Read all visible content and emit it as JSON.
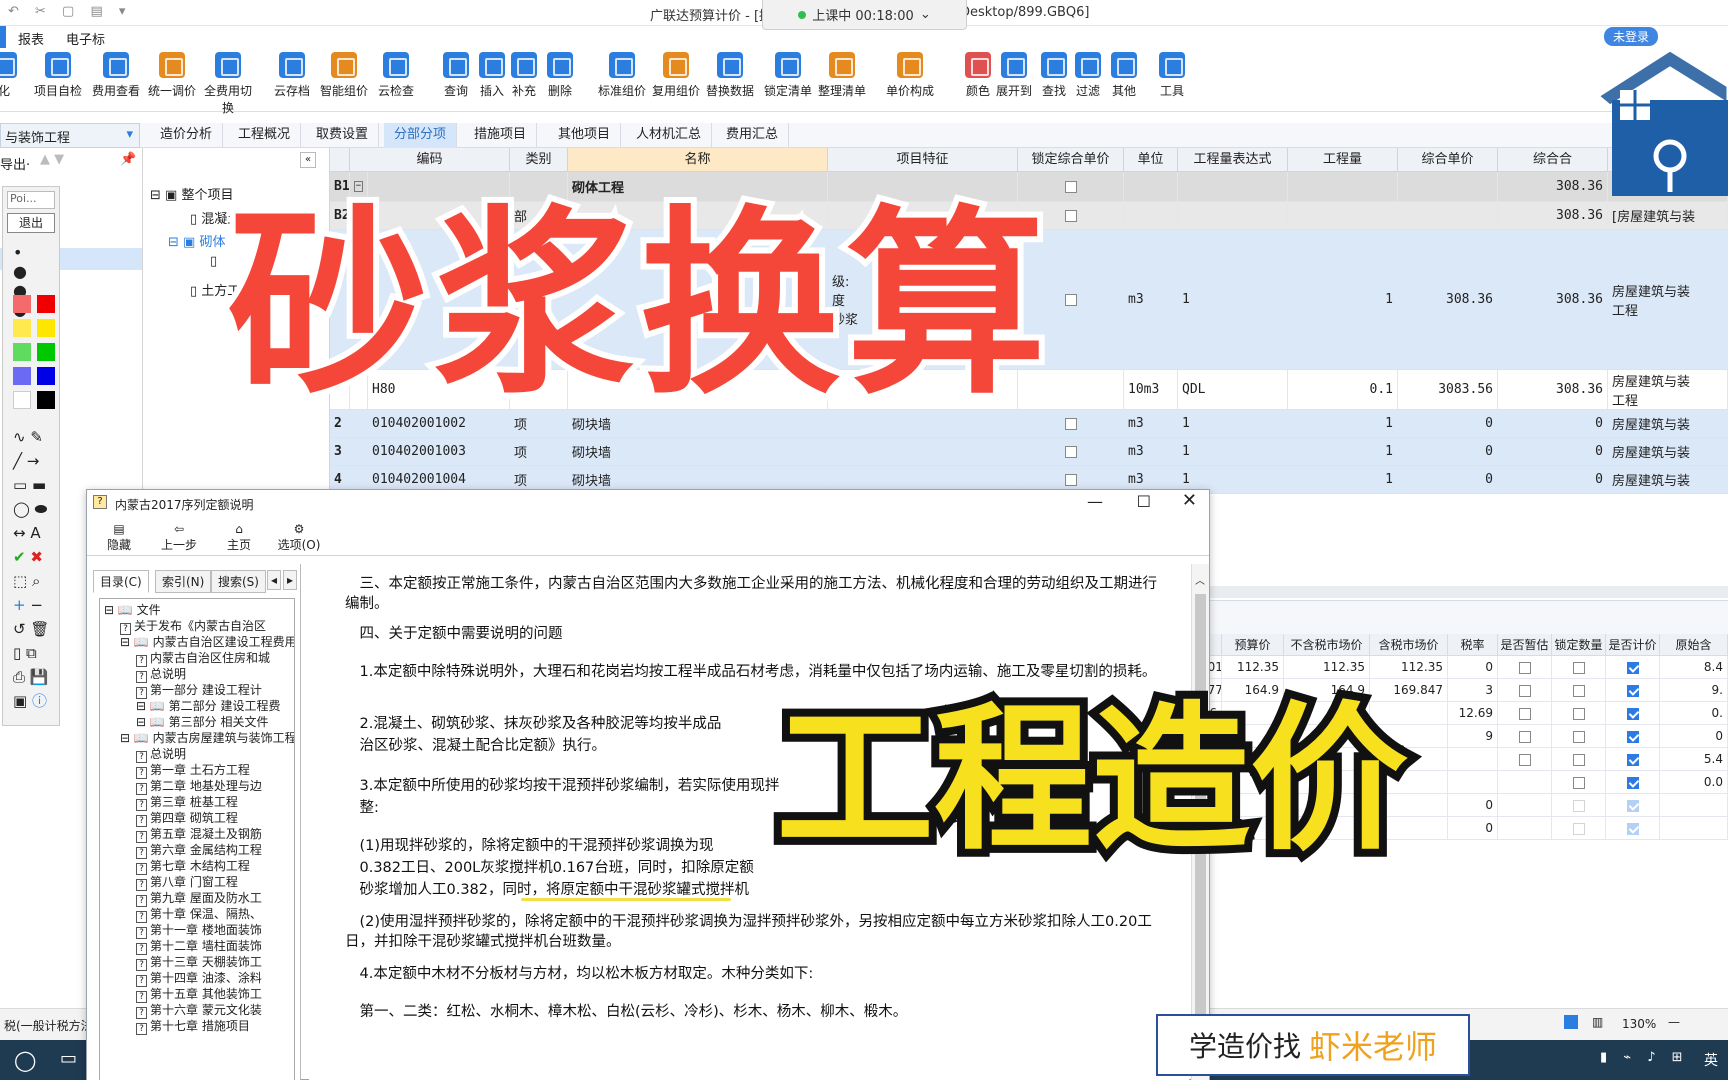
{
  "window": {
    "title": "广联达预算计价 - [招",
    "title_tail": "Desktop/899.GBQ6]",
    "timer": "上课中 00:18:00",
    "login": "未登录"
  },
  "menu": [
    "报表",
    "电子标"
  ],
  "ribbon": [
    {
      "label": "化",
      "color": "#2b7de0"
    },
    {
      "label": "项目自检",
      "color": "#2b7de0"
    },
    {
      "label": "费用查看",
      "color": "#2b7de0"
    },
    {
      "label": "统一调价",
      "color": "#e58a1f"
    },
    {
      "label": "全费用切换",
      "color": "#2b7de0"
    },
    {
      "label": "云存档",
      "color": "#2b7de0"
    },
    {
      "label": "智能组价",
      "color": "#e58a1f"
    },
    {
      "label": "云检查",
      "color": "#2b7de0"
    },
    {
      "label": "查询",
      "color": "#2b7de0"
    },
    {
      "label": "插入",
      "color": "#2b7de0"
    },
    {
      "label": "补充",
      "color": "#2b7de0"
    },
    {
      "label": "删除",
      "color": "#2b7de0"
    },
    {
      "label": "标准组价",
      "color": "#2b7de0"
    },
    {
      "label": "复用组价",
      "color": "#e58a1f"
    },
    {
      "label": "替换数据",
      "color": "#2b7de0"
    },
    {
      "label": "锁定清单",
      "color": "#2b7de0"
    },
    {
      "label": "整理清单",
      "color": "#e58a1f"
    },
    {
      "label": "单价构成",
      "color": "#e58a1f"
    },
    {
      "label": "颜色",
      "color": "#e05050"
    },
    {
      "label": "展开到",
      "color": "#2b7de0"
    },
    {
      "label": "查找",
      "color": "#2b7de0"
    },
    {
      "label": "过滤",
      "color": "#2b7de0"
    },
    {
      "label": "其他",
      "color": "#2b7de0"
    },
    {
      "label": "工具",
      "color": "#2b7de0"
    }
  ],
  "project_selector": "与装饰工程",
  "tabs": [
    "造价分析",
    "工程概况",
    "取费设置",
    "分部分项",
    "措施项目",
    "其他项目",
    "人材机汇总",
    "费用汇总"
  ],
  "left_tools": {
    "export": "导出·",
    "poi": "Poi...",
    "exit": "退出"
  },
  "tree": [
    "整个项目",
    "混凝土工程",
    "砌体",
    "土方工"
  ],
  "grid": {
    "headers": [
      "编码",
      "类别",
      "名称",
      "项目特征",
      "锁定综合单价",
      "单位",
      "工程量表达式",
      "工程量",
      "综合单价",
      "综合合"
    ],
    "rows": [
      {
        "no": "B1",
        "code": "",
        "type": "",
        "name": "砌体工程",
        "feature": "",
        "unit": "",
        "expr": "",
        "qty": "",
        "price": "",
        "total": "308.36",
        "major": "[房屋建筑与"
      },
      {
        "no": "B2",
        "code": "",
        "type": "部",
        "name": "",
        "feature": "",
        "unit": "",
        "expr": "",
        "qty": "",
        "price": "",
        "total": "308.36",
        "major": "[房屋建筑与装"
      },
      {
        "no": "",
        "code": "",
        "type": "",
        "name": "",
        "feature": "级:\n度\n砂浆",
        "unit": "m3",
        "expr": "1",
        "qty": "1",
        "price": "308.36",
        "total": "308.36",
        "major": "房屋建筑与装\n工程"
      },
      {
        "no": "",
        "code": "H80",
        "type": "",
        "name": "",
        "feature": "",
        "unit": "10m3",
        "expr": "QDL",
        "qty": "0.1",
        "price": "3083.56",
        "total": "308.36",
        "major": "房屋建筑与装\n工程"
      },
      {
        "no": "2",
        "code": "010402001002",
        "type": "项",
        "name": "砌块墙",
        "feature": "",
        "unit": "m3",
        "expr": "1",
        "qty": "1",
        "price": "0",
        "total": "0",
        "major": "房屋建筑与装"
      },
      {
        "no": "3",
        "code": "010402001003",
        "type": "项",
        "name": "砌块墙",
        "feature": "",
        "unit": "m3",
        "expr": "1",
        "qty": "1",
        "price": "0",
        "total": "0",
        "major": "房屋建筑与装"
      },
      {
        "no": "4",
        "code": "010402001004",
        "type": "项",
        "name": "砌块墙",
        "feature": "",
        "unit": "m3",
        "expr": "1",
        "qty": "1",
        "price": "0",
        "total": "0",
        "major": "房屋建筑与装"
      }
    ]
  },
  "lower_grid": {
    "headers": [
      "",
      "预算价",
      "不含税市场价",
      "含税市场价",
      "税率",
      "是否暂估",
      "锁定数量",
      "是否计价",
      "原始含"
    ],
    "rows": [
      {
        "c0": "801",
        "c1": "112.35",
        "c2": "112.35",
        "c3": "112.35",
        "c4": "0",
        "est": false,
        "lock": false,
        "calc": true,
        "c8": "8.4"
      },
      {
        "c0": "977",
        "c1": "164.9",
        "c2": "164.9",
        "c3": "169.847",
        "c4": "3",
        "est": false,
        "lock": false,
        "calc": true,
        "c8": "9."
      },
      {
        "c0": "86",
        "c1": "",
        "c2": "",
        "c3": "",
        "c4": "12.69",
        "est": false,
        "lock": false,
        "calc": true,
        "c8": "0."
      },
      {
        "c0": "",
        "c1": "",
        "c2": "",
        "c3": "",
        "c4": "9",
        "est": false,
        "lock": false,
        "calc": true,
        "c8": "0"
      },
      {
        "c0": "",
        "c1": "",
        "c2": "",
        "c3": "",
        "c4": "",
        "est": false,
        "lock": false,
        "calc": true,
        "c8": "5.4"
      },
      {
        "c0": "",
        "c1": "",
        "c2": "",
        "c3": "",
        "c4": "",
        "est": false,
        "lock": false,
        "calc": true,
        "c8": "0.0"
      },
      {
        "c0": "",
        "c1": "",
        "c2": "",
        "c3": "",
        "c4": "0",
        "est": false,
        "lock": false,
        "calc": true,
        "c8": ""
      },
      {
        "c0": "",
        "c1": "",
        "c2": "",
        "c3": "",
        "c4": "0",
        "est": false,
        "lock": false,
        "calc": true,
        "c8": ""
      }
    ]
  },
  "help": {
    "title": "内蒙古2017序列定额说明",
    "tools": [
      "隐藏",
      "上一步",
      "主页",
      "选项(O)"
    ],
    "tabs": [
      "目录(C)",
      "索引(N)",
      "搜索(S)"
    ],
    "tree": [
      {
        "t": "文件",
        "lvl": 0,
        "kind": "book"
      },
      {
        "t": "关于发布《内蒙古自治区",
        "lvl": 1,
        "kind": "q"
      },
      {
        "t": "内蒙古自治区建设工程费用",
        "lvl": 1,
        "kind": "book"
      },
      {
        "t": "内蒙古自治区住房和城",
        "lvl": 2,
        "kind": "q"
      },
      {
        "t": "总说明",
        "lvl": 2,
        "kind": "q"
      },
      {
        "t": "第一部分 建设工程计",
        "lvl": 2,
        "kind": "q"
      },
      {
        "t": "第二部分 建设工程费",
        "lvl": 2,
        "kind": "book"
      },
      {
        "t": "第三部分 相关文件",
        "lvl": 2,
        "kind": "book"
      },
      {
        "t": "内蒙古房屋建筑与装饰工程",
        "lvl": 1,
        "kind": "book"
      },
      {
        "t": "总说明",
        "lvl": 2,
        "kind": "q"
      },
      {
        "t": "第一章 土石方工程",
        "lvl": 2,
        "kind": "q"
      },
      {
        "t": "第二章 地基处理与边",
        "lvl": 2,
        "kind": "q"
      },
      {
        "t": "第三章 桩基工程",
        "lvl": 2,
        "kind": "q"
      },
      {
        "t": "第四章 砌筑工程",
        "lvl": 2,
        "kind": "q"
      },
      {
        "t": "第五章 混凝土及钢筋",
        "lvl": 2,
        "kind": "q"
      },
      {
        "t": "第六章 金属结构工程",
        "lvl": 2,
        "kind": "q"
      },
      {
        "t": "第七章 木结构工程",
        "lvl": 2,
        "kind": "q"
      },
      {
        "t": "第八章 门窗工程",
        "lvl": 2,
        "kind": "q"
      },
      {
        "t": "第九章 屋面及防水工",
        "lvl": 2,
        "kind": "q"
      },
      {
        "t": "第十章 保温、隔热、",
        "lvl": 2,
        "kind": "q"
      },
      {
        "t": "第十一章 楼地面装饰",
        "lvl": 2,
        "kind": "q"
      },
      {
        "t": "第十二章 墙柱面装饰",
        "lvl": 2,
        "kind": "q"
      },
      {
        "t": "第十三章 天棚装饰工",
        "lvl": 2,
        "kind": "q"
      },
      {
        "t": "第十四章 油漆、涂料",
        "lvl": 2,
        "kind": "q"
      },
      {
        "t": "第十五章 其他装饰工",
        "lvl": 2,
        "kind": "q"
      },
      {
        "t": "第十六章 蒙元文化装",
        "lvl": 2,
        "kind": "q"
      },
      {
        "t": "第十七章 措施项目",
        "lvl": 2,
        "kind": "q"
      }
    ],
    "paras": [
      "三、本定额按正常施工条件，内蒙古自治区范围内大多数施工企业采用的施工方法、机械化程度和合理的劳动组织及工期进行编制。",
      "四、关于定额中需要说明的问题",
      "1.本定额中除特殊说明外，大理石和花岗岩均按工程半成品石材考虑，消耗量中仅包括了场内运输、施工及零星切割的损耗。",
      "2.混凝土、砌筑砂浆、抹灰砂浆及各种胶泥等均按半成品",
      "治区砂浆、混凝土配合比定额》执行。",
      "3.本定额中所使用的砂浆均按干混预拌砂浆编制，若实际使用现拌",
      "整:",
      "(1)用现拌砂浆的，除将定额中的干混预拌砂浆调换为现",
      "0.382工日、200L灰浆搅拌机0.167台班，同时，扣除原定额",
      "砂浆增加人工0.382，同时，将原定额中干混砂浆罐式搅拌机",
      "(2)使用湿拌预拌砂浆的，除将定额中的干混预拌砂浆调换为湿拌预拌砂浆外，另按相应定额中每立方米砂浆扣除人工0.20工日，并扣除干混砂浆罐式搅拌机台班数量。",
      "4.本定额中木材不分板材与方材，均以松木板方材取定。木种分类如下:",
      "第一、二类：红松、水桐木、樟木松、白松(云杉、冷杉)、杉木、杨木、柳木、椴木。"
    ]
  },
  "overlay": {
    "red": "砂浆换算",
    "yellow": "工程造价",
    "watermark_a": "学造价找",
    "watermark_b": "虾米老师"
  },
  "status": {
    "left": "税(一般计税方法",
    "zoom": "130%",
    "ime": "英"
  }
}
